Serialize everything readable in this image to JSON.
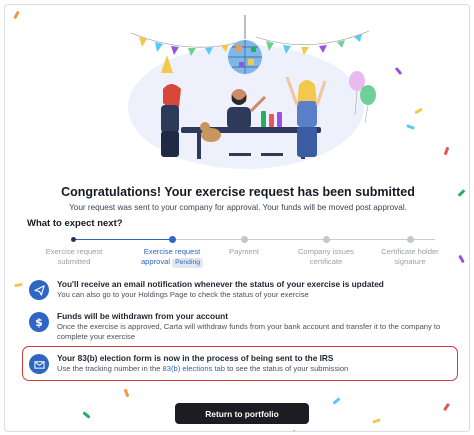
{
  "headline": "Congratulations! Your exercise request has been submitted",
  "subline": "Your request was sent to your company for approval. Your funds will be moved post approval.",
  "expect_title": "What to expect next?",
  "steps": [
    {
      "line1": "Exercise request",
      "line2": "submitted",
      "state": "done"
    },
    {
      "line1": "Exercise request",
      "line2": "approval",
      "badge": "Pending",
      "state": "current"
    },
    {
      "line1": "Payment",
      "line2": "",
      "state": "upcoming"
    },
    {
      "line1": "Company issues",
      "line2": "certificate",
      "state": "upcoming"
    },
    {
      "line1": "Certificate holder",
      "line2": "signature",
      "state": "upcoming"
    }
  ],
  "items": [
    {
      "icon": "paper-plane-icon",
      "title": "You'll receive an email notification whenever the status of your exercise is updated",
      "desc": "You can also go to your Holdings Page to check the status of your exercise"
    },
    {
      "icon": "dollar-icon",
      "title": "Funds will be withdrawn from your account",
      "desc": "Once the exercise is approved, Carta will withdraw funds from your bank account and transfer it to the company to complete your exercise"
    },
    {
      "icon": "mail-icon",
      "title": "Your 83(b) election form is now in the process of being sent to the IRS",
      "desc_before": "Use the tracking number in the ",
      "desc_link": "83(b) elections tab",
      "desc_after": " to see the status of your submission"
    }
  ],
  "cta_label": "Return to portfolio",
  "colors": {
    "accent": "#2f66c4",
    "highlight": "#d23b3b",
    "cta": "#1b1d22"
  }
}
